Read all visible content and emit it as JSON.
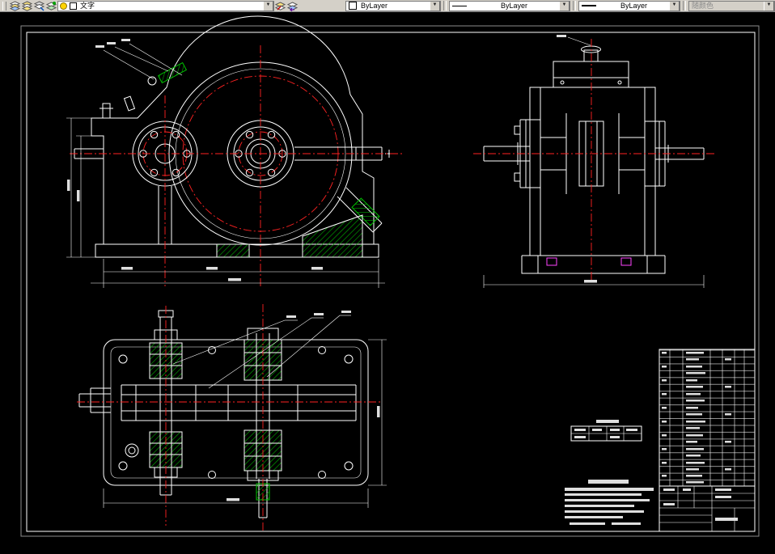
{
  "toolbar": {
    "layer_buttons": [
      {
        "name": "layer-properties-manager"
      },
      {
        "name": "layer-states-manager"
      },
      {
        "name": "layer-filter"
      },
      {
        "name": "layer-make-current"
      }
    ],
    "layer_dropdown": {
      "value": "文字"
    },
    "layer_extra_buttons": [
      {
        "name": "make-object-layer-current"
      },
      {
        "name": "layer-previous"
      }
    ],
    "color_dropdown": {
      "value": "ByLayer"
    },
    "linetype_dropdown": {
      "value": "ByLayer"
    },
    "lineweight_dropdown": {
      "value": "ByLayer"
    },
    "plotstyle_dropdown": {
      "value": "随颜色",
      "disabled": true
    }
  },
  "drawing": {
    "colors": {
      "background": "#000000",
      "object_lines": "#ffffff",
      "centerlines": "#ff2222",
      "hatch": "#00c000",
      "accent": "#ff44ff"
    },
    "views": {
      "front_view": "gearbox-front-view",
      "side_view": "gearbox-side-view",
      "plan_view": "gearbox-plan-section-view",
      "parts_list": "parts-list-table",
      "title_block": "title-block",
      "notes": "technical-notes"
    }
  }
}
